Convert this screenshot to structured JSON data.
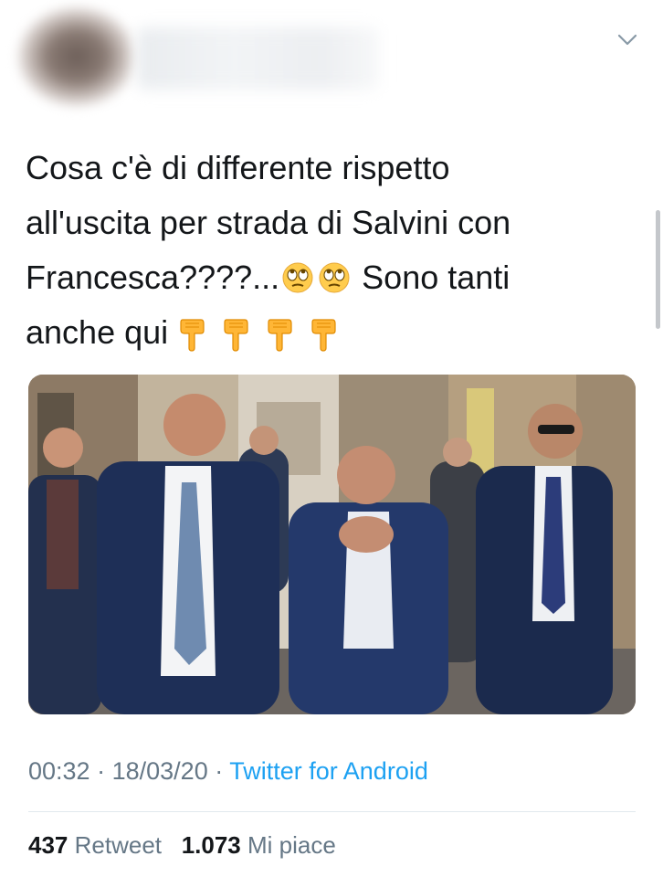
{
  "tweet": {
    "text_line_1": "Cosa c'è di differente rispetto",
    "text_line_2": "all'uscita per strada di Salvini con",
    "text_line_3_a": "Francesca????...",
    "text_line_3_b": "Sono tanti",
    "text_line_4": "anche qui",
    "emoji": [
      "face-with-rolling-eyes",
      "face-with-rolling-eyes",
      "pointing-down",
      "pointing-down",
      "pointing-down",
      "pointing-down"
    ]
  },
  "meta": {
    "time": "00:32",
    "date": "18/03/20",
    "separator": "·",
    "source": "Twitter for Android"
  },
  "stats": {
    "retweets_count": "437",
    "retweets_label": "Retweet",
    "likes_count": "1.073",
    "likes_label": "Mi piace"
  },
  "icons": {
    "menu": "chevron-down-icon"
  },
  "colors": {
    "text": "#14171a",
    "secondary": "#657786",
    "link": "#1da1f2",
    "divider": "#e1e8ed"
  }
}
